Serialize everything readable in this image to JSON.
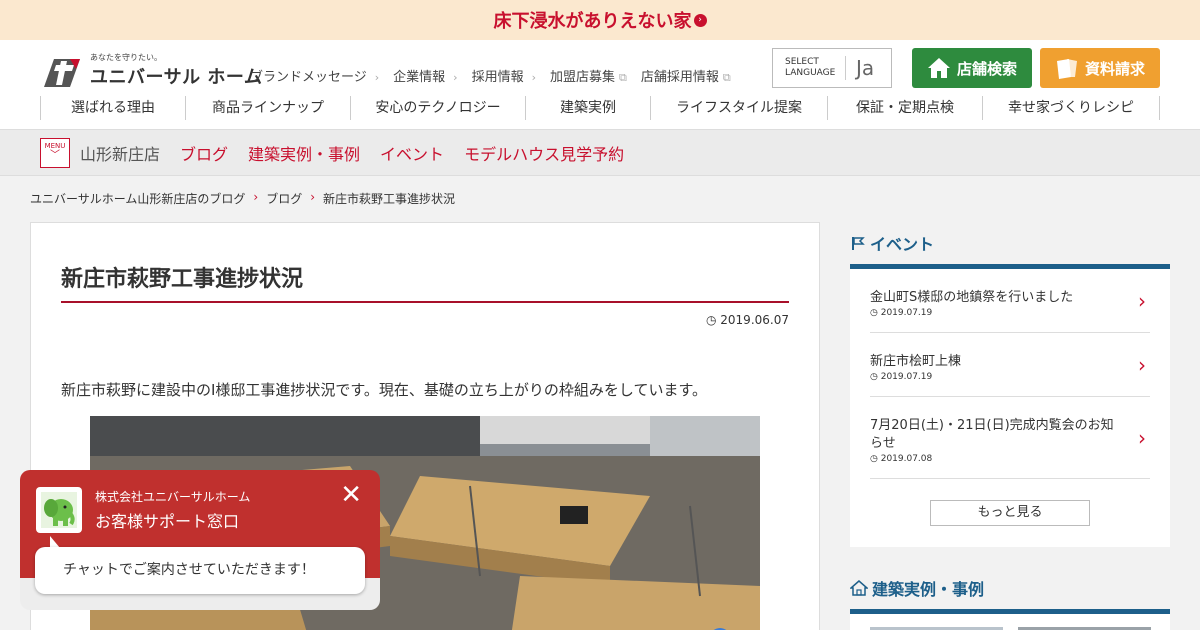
{
  "promo": {
    "text": "床下浸水がありえない家",
    "arrow_icon": "circle-chevron-right-icon"
  },
  "brand": {
    "tagline": "あなたを守りたい。",
    "name": "ユニバーサル ホーム"
  },
  "utility_nav": [
    {
      "label": "ブランドメッセージ",
      "icon": "chevron-right-icon"
    },
    {
      "label": "企業情報",
      "icon": "chevron-right-icon"
    },
    {
      "label": "採用情報",
      "icon": "chevron-right-icon"
    },
    {
      "label": "加盟店募集",
      "icon": "external-link-icon"
    },
    {
      "label": "店舗採用情報",
      "icon": "external-link-icon"
    }
  ],
  "language": {
    "label_line1": "SELECT",
    "label_line2": "LANGUAGE",
    "value": "Ja"
  },
  "header_buttons": {
    "store_search": {
      "label": "店舗検索",
      "color": "#2e8b3e",
      "icon": "house-icon"
    },
    "request_docs": {
      "label": "資料請求",
      "color": "#f0a030",
      "icon": "document-icon"
    }
  },
  "main_nav": [
    "選ばれる理由",
    "商品ラインナップ",
    "安心のテクノロジー",
    "建築実例",
    "ライフスタイル提案",
    "保証・定期点検",
    "幸せ家づくりレシピ"
  ],
  "sub_bar": {
    "menu_label": "MENU",
    "store_name": "山形新庄店",
    "links": [
      "ブログ",
      "建築実例・事例",
      "イベント",
      "モデルハウス見学予約"
    ]
  },
  "breadcrumb": [
    "ユニバーサルホーム山形新庄店のブログ",
    "ブログ",
    "新庄市萩野工事進捗状況"
  ],
  "article": {
    "title": "新庄市萩野工事進捗状況",
    "date": "2019.06.07",
    "body": "新庄市萩野に建設中のI様邸工事進捗状況です。現在、基礎の立ち上がりの枠組みをしています。",
    "photo_icon": "construction-photo"
  },
  "sidebar": {
    "events_heading": "イベント",
    "events_icon": "flag-icon",
    "events": [
      {
        "title": "金山町S様邸の地鎮祭を行いました",
        "date": "2019.07.19"
      },
      {
        "title": "新庄市桧町上棟",
        "date": "2019.07.19"
      },
      {
        "title": "7月20日(土)・21日(日)完成内覧会のお知らせ",
        "date": "2019.07.08"
      }
    ],
    "more_label": "もっと見る",
    "cases_heading": "建築実例・事例",
    "cases_icon": "house-outline-icon"
  },
  "chat": {
    "company": "株式会社ユニバーサルホーム",
    "window_name": "お客様サポート窓口",
    "message": "チャットでご案内させていただきます！",
    "avatar_icon": "elephant-mascot-icon",
    "color": "#c0302e"
  },
  "colors": {
    "accent": "#c8102e",
    "sidebar_blue": "#1d5f8a",
    "promo_bg": "#fbe8cf"
  }
}
